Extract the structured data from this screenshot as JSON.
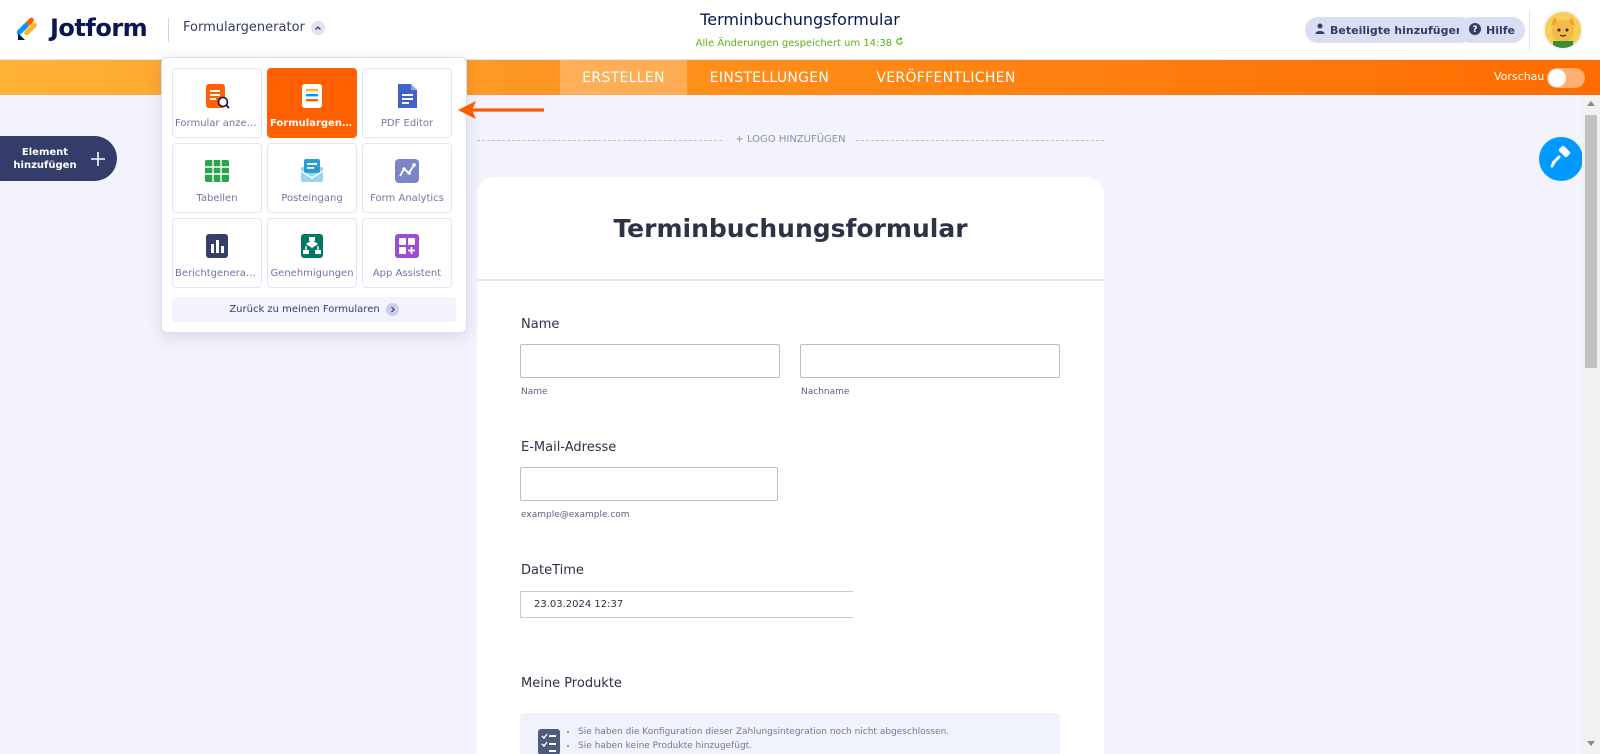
{
  "header": {
    "brand": "Jotform",
    "app_switcher": "Formulargenerator",
    "form_title": "Terminbuchungsformular",
    "save_status": "Alle Änderungen gespeichert um 14:38",
    "add_participants": "Beteiligte hinzufügen",
    "help": "Hilfe"
  },
  "nav": {
    "tabs": [
      "ERSTELLEN",
      "EINSTELLUNGEN",
      "VERÖFFENTLICHEN"
    ],
    "preview_label": "Vorschau"
  },
  "sidebar": {
    "add_element_line1": "Element",
    "add_element_line2": "hinzufügen"
  },
  "app_menu": {
    "tiles": [
      {
        "label": "Formular anzeigen",
        "icon": "form-view-icon",
        "color": "#ff6100"
      },
      {
        "label": "Formulargenerator",
        "icon": "form-builder-icon",
        "color": "#ff6100"
      },
      {
        "label": "PDF Editor",
        "icon": "pdf-editor-icon",
        "color": "#3e62c8"
      },
      {
        "label": "Tabellen",
        "icon": "tables-icon",
        "color": "#2ba24c"
      },
      {
        "label": "Posteingang",
        "icon": "inbox-icon",
        "color": "#2c9ecd"
      },
      {
        "label": "Form Analytics",
        "icon": "analytics-icon",
        "color": "#7c85c7"
      },
      {
        "label": "Berichtgenerator",
        "icon": "report-icon",
        "color": "#344067"
      },
      {
        "label": "Genehmigungen",
        "icon": "approvals-icon",
        "color": "#007862"
      },
      {
        "label": "App Assistent",
        "icon": "app-builder-icon",
        "color": "#9c4dd3"
      }
    ],
    "back_label": "Zurück zu meinen Formularen"
  },
  "form": {
    "logo_add": "+ LOGO HINZUFÜGEN",
    "title": "Terminbuchungsformular",
    "name_label": "Name",
    "first_sub": "Name",
    "last_sub": "Nachname",
    "email_label": "E-Mail-Adresse",
    "email_sub": "example@example.com",
    "datetime_label": "DateTime",
    "datetime_value": "23.03.2024 12:37",
    "products_label": "Meine Produkte",
    "products_notices": [
      "Sie haben die Konfiguration dieser Zahlungsintegration noch nicht abgeschlossen.",
      "Sie haben keine Produkte hinzugefügt."
    ]
  },
  "colors": {
    "accent": "#ff6100",
    "navy": "#0a1551",
    "success": "#59b21d",
    "blue": "#0099ff"
  }
}
